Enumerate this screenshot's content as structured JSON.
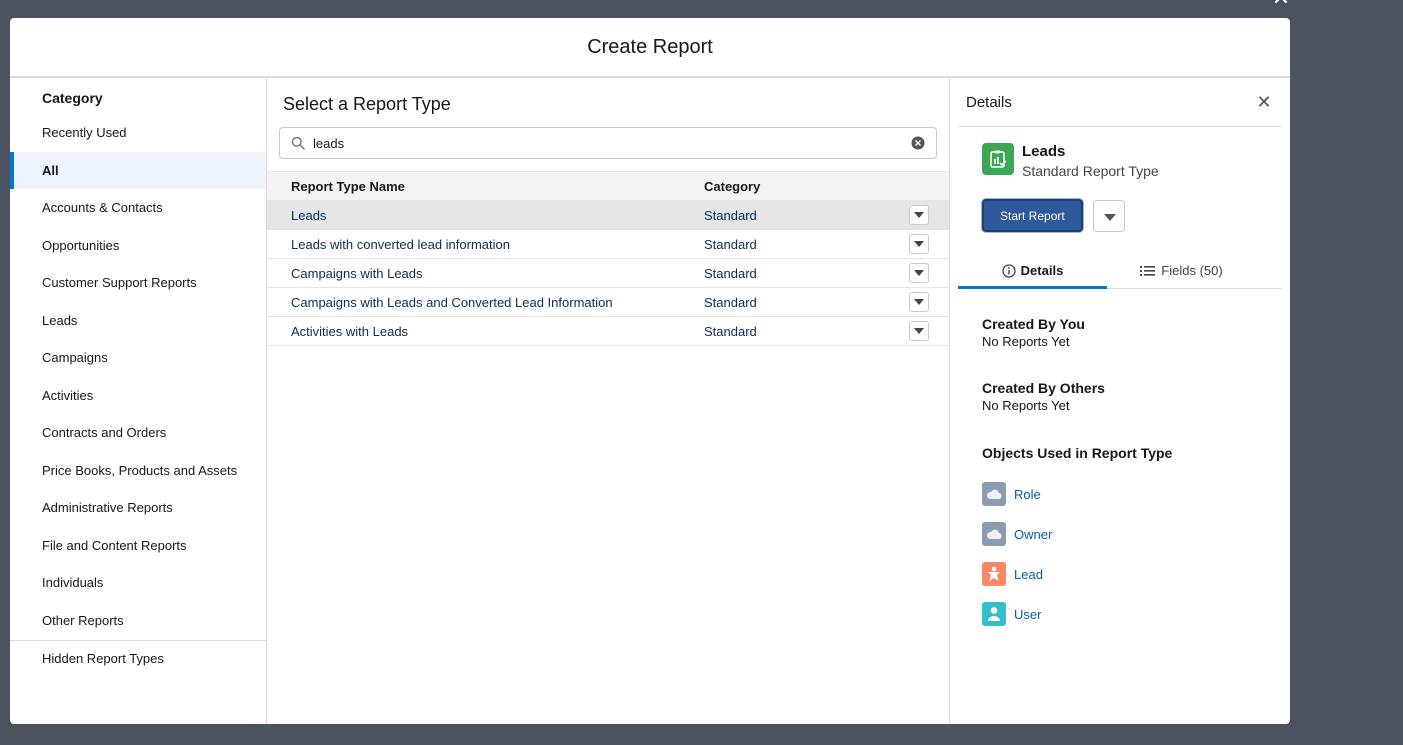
{
  "modal": {
    "title": "Create Report"
  },
  "sidebar": {
    "heading": "Category",
    "items": [
      {
        "label": "Recently Used",
        "active": false
      },
      {
        "label": "All",
        "active": true
      },
      {
        "label": "Accounts & Contacts",
        "active": false
      },
      {
        "label": "Opportunities",
        "active": false
      },
      {
        "label": "Customer Support Reports",
        "active": false
      },
      {
        "label": "Leads",
        "active": false
      },
      {
        "label": "Campaigns",
        "active": false
      },
      {
        "label": "Activities",
        "active": false
      },
      {
        "label": "Contracts and Orders",
        "active": false
      },
      {
        "label": "Price Books, Products and Assets",
        "active": false
      },
      {
        "label": "Administrative Reports",
        "active": false
      },
      {
        "label": "File and Content Reports",
        "active": false
      },
      {
        "label": "Individuals",
        "active": false
      },
      {
        "label": "Other Reports",
        "active": false
      }
    ],
    "hidden": "Hidden Report Types"
  },
  "center": {
    "title": "Select a Report Type",
    "search": {
      "value": "leads",
      "placeholder": ""
    },
    "columns": {
      "name": "Report Type Name",
      "category": "Category"
    },
    "rows": [
      {
        "name": "Leads",
        "category": "Standard",
        "selected": true
      },
      {
        "name": "Leads with converted lead information",
        "category": "Standard",
        "selected": false
      },
      {
        "name": "Campaigns with Leads",
        "category": "Standard",
        "selected": false
      },
      {
        "name": "Campaigns with Leads and Converted Lead Information",
        "category": "Standard",
        "selected": false
      },
      {
        "name": "Activities with Leads",
        "category": "Standard",
        "selected": false
      }
    ]
  },
  "details": {
    "header": "Details",
    "report_type": {
      "name": "Leads",
      "type": "Standard Report Type",
      "icon": "report-type-icon",
      "icon_color": "#3ba755"
    },
    "start_label": "Start Report",
    "tabs": {
      "details": "Details",
      "fields": "Fields (50)"
    },
    "created_by_you": {
      "title": "Created By You",
      "value": "No Reports Yet"
    },
    "created_by_others": {
      "title": "Created By Others",
      "value": "No Reports Yet"
    },
    "objects_title": "Objects Used in Report Type",
    "objects": [
      {
        "label": "Role",
        "icon": "cloud-icon",
        "color": "#8b9bb0"
      },
      {
        "label": "Owner",
        "icon": "cloud-icon",
        "color": "#8b9bb0"
      },
      {
        "label": "Lead",
        "icon": "lead-icon",
        "color": "#f88962"
      },
      {
        "label": "User",
        "icon": "user-icon",
        "color": "#34becd"
      }
    ]
  }
}
